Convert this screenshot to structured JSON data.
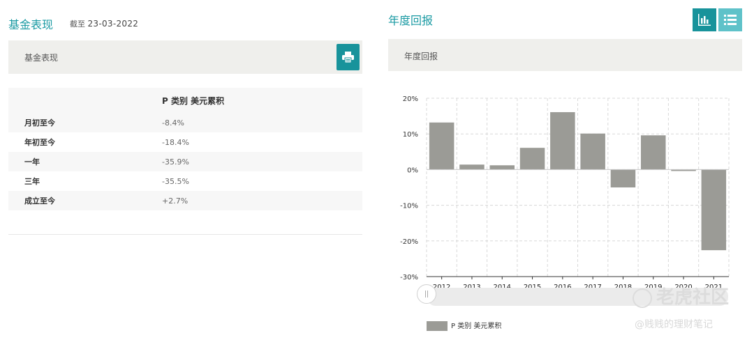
{
  "left": {
    "title": "基金表现",
    "as_of_prefix": "截至",
    "as_of_date": "23-03-2022",
    "bar_label": "基金表现",
    "table": {
      "column_header": "P 类别 美元累积",
      "rows": [
        {
          "label": "月初至今",
          "value": "-8.4%"
        },
        {
          "label": "年初至今",
          "value": "-18.4%"
        },
        {
          "label": "一年",
          "value": "-35.9%"
        },
        {
          "label": "三年",
          "value": "-35.5%"
        },
        {
          "label": "成立至今",
          "value": "+2.7%"
        }
      ]
    }
  },
  "right": {
    "title": "年度回报",
    "bar_label": "年度回报"
  },
  "watermark": {
    "text": "老虎社区",
    "credit": "@贱贱的理财笔记"
  },
  "colors": {
    "accent": "#1a9aa3",
    "bar": "#9b9b96"
  },
  "icons": {
    "print": "printer-icon",
    "chart_view": "bar-chart-icon",
    "list_view": "list-icon"
  },
  "chart_data": {
    "type": "bar",
    "categories": [
      "2012",
      "2013",
      "2014",
      "2015",
      "2016",
      "2017",
      "2018",
      "2019",
      "2020",
      "2021"
    ],
    "series": [
      {
        "name": "P 类别 美元累积",
        "values": [
          13.2,
          1.4,
          1.2,
          6.1,
          16.1,
          10.1,
          -5.0,
          9.6,
          -0.4,
          -22.6
        ]
      }
    ],
    "ylim": [
      -30,
      20
    ],
    "yticks": [
      20,
      10,
      0,
      -10,
      -20,
      -30
    ],
    "ytick_labels": [
      "20%",
      "10%",
      "0%",
      "-10%",
      "-20%",
      "-30%"
    ],
    "grid": true,
    "legend": "bottom-left",
    "xlabel": "",
    "ylabel": ""
  }
}
